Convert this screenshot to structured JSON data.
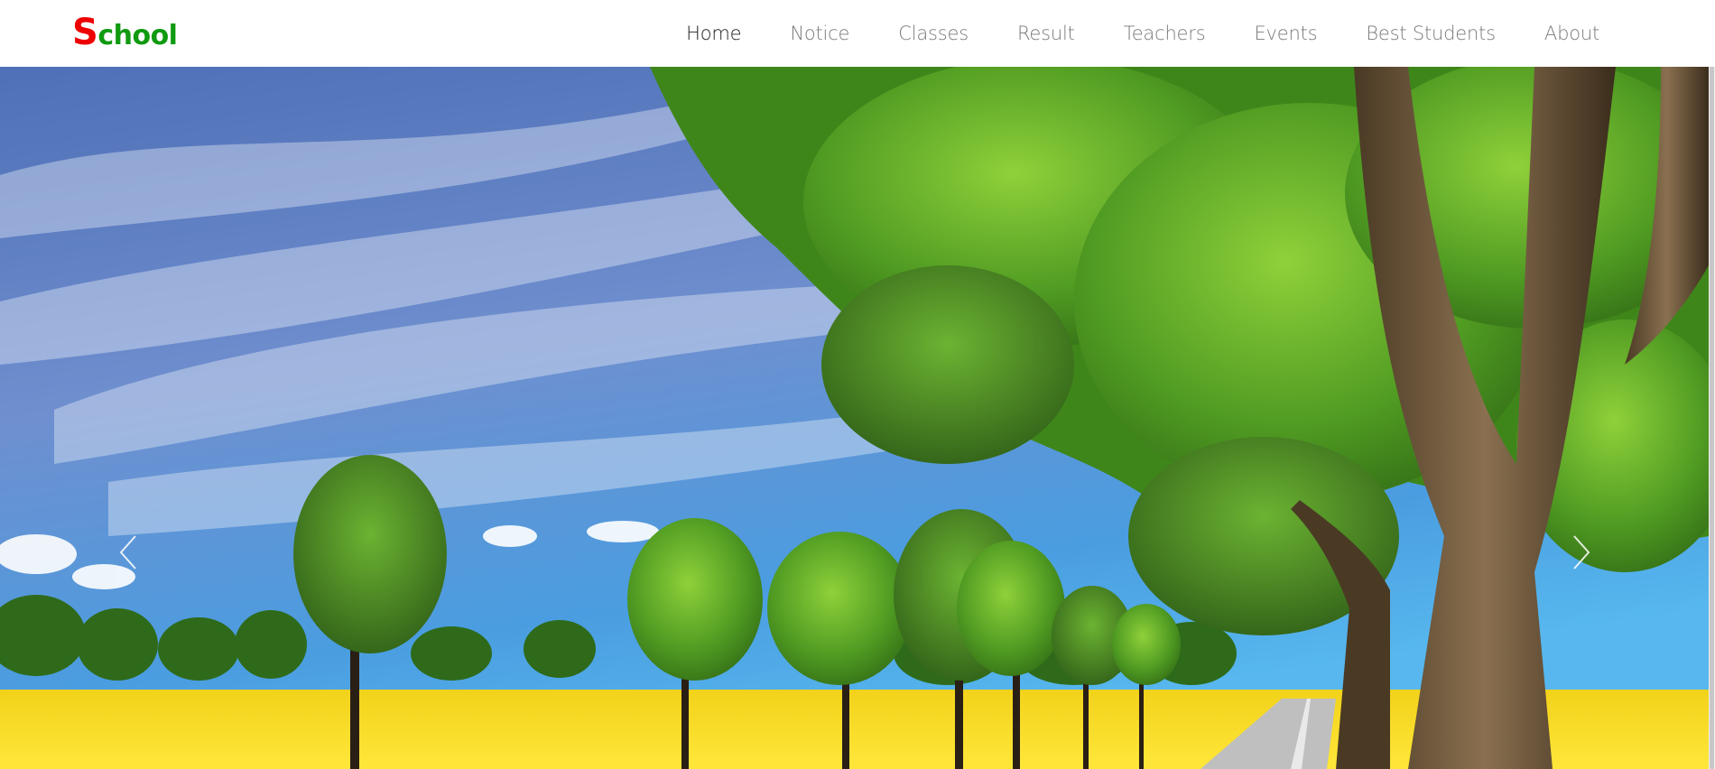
{
  "brand": {
    "first_letter": "S",
    "rest": "chool",
    "first_color": "#ee0000",
    "rest_color": "#109a10"
  },
  "nav": {
    "items": [
      {
        "label": "Home",
        "active": true
      },
      {
        "label": "Notice",
        "active": false
      },
      {
        "label": "Classes",
        "active": false
      },
      {
        "label": "Result",
        "active": false
      },
      {
        "label": "Teachers",
        "active": false
      },
      {
        "label": "Events",
        "active": false
      },
      {
        "label": "Best Students",
        "active": false
      },
      {
        "label": "About",
        "active": false
      }
    ]
  },
  "carousel": {
    "prev_icon": "chevron-left-icon",
    "next_icon": "chevron-right-icon"
  }
}
